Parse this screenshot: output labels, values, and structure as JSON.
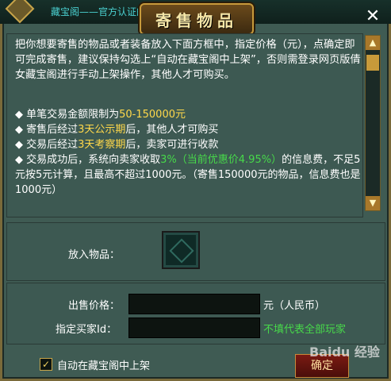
{
  "header": {
    "ticker": "藏宝阁——官方认证的游戏交易平台，为满",
    "title": "寄售物品",
    "close_symbol": "✕"
  },
  "description": {
    "intro": "把你想要寄售的物品或者装备放入下面方框中，指定价格（元），点确定即可完成寄售，建议保持勾选上“自动在藏宝阁中上架”，否则需登录网页版倩女藏宝阁进行手动上架操作，其他人才可购买。",
    "rules": [
      {
        "prefix": "◆  单笔交易金额限制为",
        "highlight": "50-150000元",
        "suffix": ""
      },
      {
        "prefix": "◆  寄售后经过",
        "highlight": "3天公示期",
        "suffix": "后，其他人才可购买"
      },
      {
        "prefix": "◆  交易后经过",
        "highlight": "3天考察期",
        "suffix": "后，卖家可进行收款"
      },
      {
        "prefix": "◆  交易成功后，系统向卖家收取",
        "highlight": "3%（当前优惠价4.95%）",
        "suffix": "的信息费，不足5元按5元计算，且最高不超过1000元。（寄售150000元的物品，信息费也是1000元）"
      }
    ]
  },
  "form": {
    "item_label": "放入物品：",
    "price_label": "出售价格：",
    "price_value": "",
    "price_unit": "元（人民币）",
    "buyer_label": "指定买家Id：",
    "buyer_value": "",
    "buyer_hint": "不填代表全部玩家"
  },
  "footer": {
    "auto_list_label": "自动在藏宝阁中上架",
    "auto_list_checked": true,
    "confirm_label": "确定",
    "watermark": "Baidu 经验"
  },
  "colors": {
    "highlight": "#47d94a",
    "panel": "#3d5952",
    "gold": "#c7a44a"
  }
}
